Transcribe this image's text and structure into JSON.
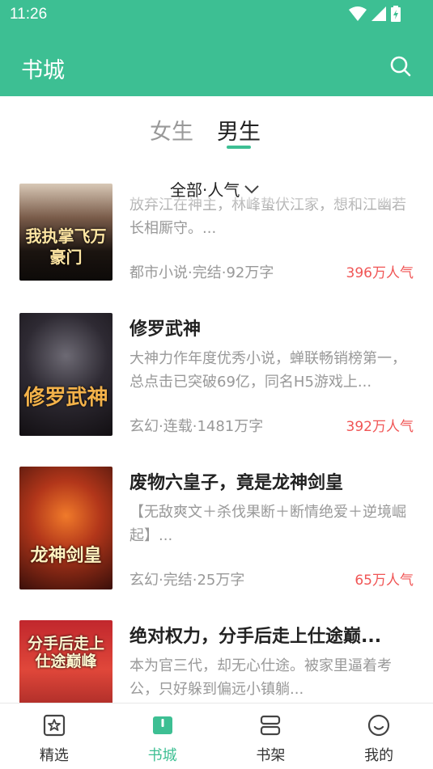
{
  "status": {
    "time": "11:26"
  },
  "header": {
    "title": "书城"
  },
  "tabs": [
    {
      "label": "女生",
      "active": false
    },
    {
      "label": "男生",
      "active": true
    }
  ],
  "filter": {
    "label": "全部·人气"
  },
  "books": [
    {
      "title": "",
      "desc": "放弃江在神主，林峰蛰伏江家，想和江幽若长相厮守。...",
      "meta": "都市小说·完结·92万字",
      "popularity": "396万人气",
      "cover_text": "我执掌飞万豪门"
    },
    {
      "title": "修罗武神",
      "desc": "大神力作年度优秀小说，蝉联畅销榜第一，总点击已突破69亿，同名H5游戏上...",
      "meta": "玄幻·连载·1481万字",
      "popularity": "392万人气",
      "cover_text": "修罗武神"
    },
    {
      "title": "废物六皇子，竟是龙神剑皇",
      "desc": "【无敌爽文＋杀伐果断＋断情绝爱＋逆境崛起】...",
      "meta": "玄幻·完结·25万字",
      "popularity": "65万人气",
      "cover_text": "龙神剑皇"
    },
    {
      "title": "绝对权力，分手后走上仕途巅...",
      "desc": "本为官三代，却无心仕途。被家里逼着考公，只好躲到偏远小镇躺...",
      "meta": "",
      "popularity": "",
      "cover_text": "分手后走上仕途巅峰"
    }
  ],
  "bottom_nav": [
    {
      "label": "精选",
      "icon": "star-bookmark-icon",
      "active": false
    },
    {
      "label": "书城",
      "icon": "bookstore-icon",
      "active": true
    },
    {
      "label": "书架",
      "icon": "bookshelf-icon",
      "active": false
    },
    {
      "label": "我的",
      "icon": "smile-profile-icon",
      "active": false
    }
  ],
  "colors": {
    "accent": "#3dbf93",
    "popularity": "#f05555"
  }
}
